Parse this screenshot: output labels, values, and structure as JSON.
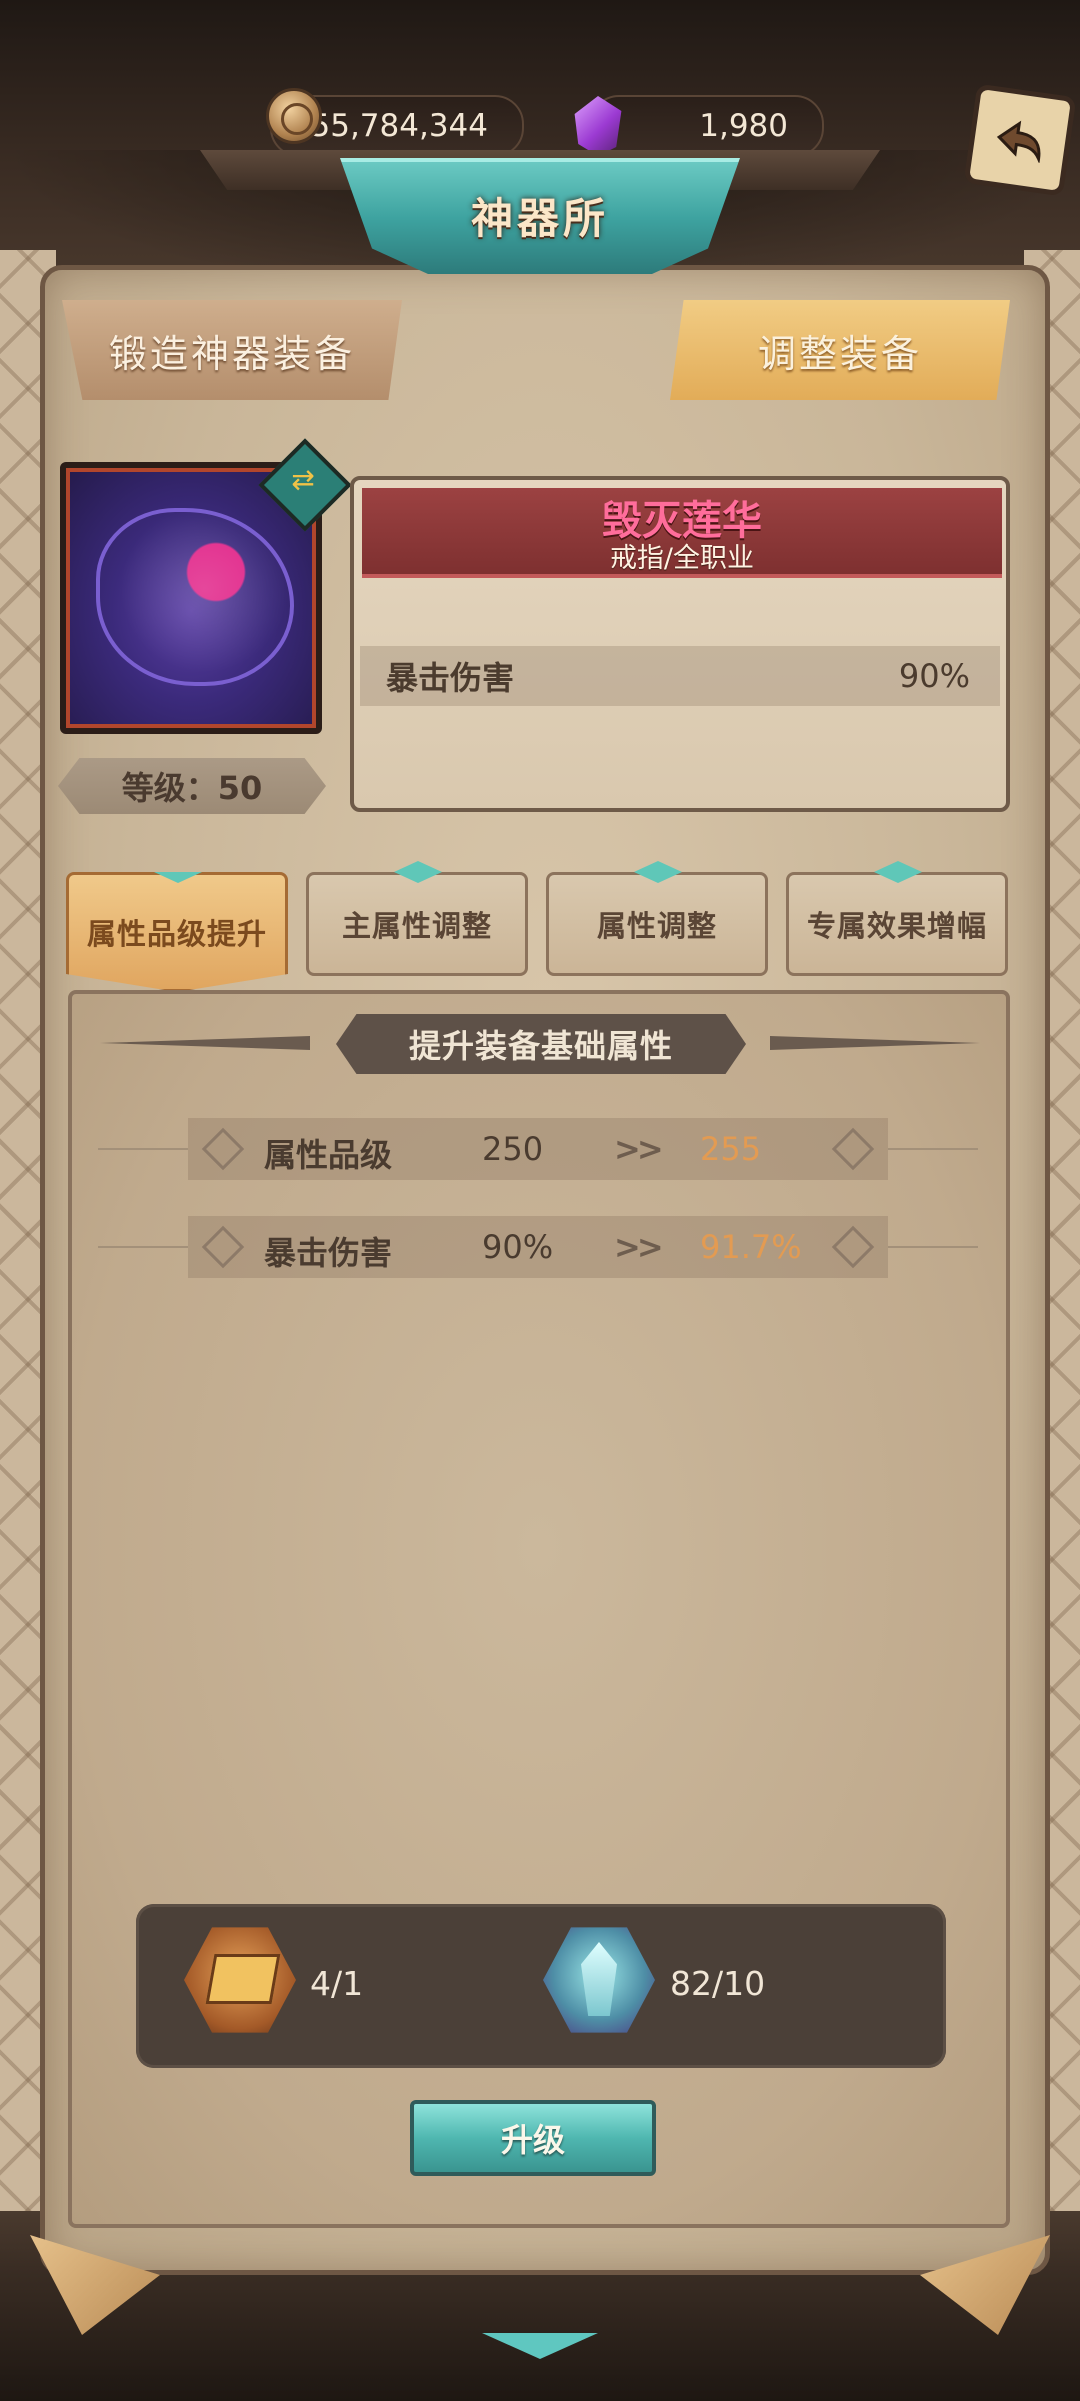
{
  "currency": {
    "gold_icon": "coin-icon",
    "gold": "55,784,344",
    "gem_icon": "purple-gem-icon",
    "gems": "1,980"
  },
  "header": {
    "title": "神器所",
    "back_icon": "back-arrow-icon"
  },
  "top_buttons": {
    "forge": "锻造神器装备",
    "adjust": "调整装备"
  },
  "item": {
    "name": "毁灭莲华",
    "type": "戒指/全职业",
    "level": "等级：50",
    "stat_label": "暴击伤害",
    "stat_value": "90%",
    "name_color": "#ff6d9b"
  },
  "tabs": [
    {
      "label": "属性品级提升",
      "active": true
    },
    {
      "label": "主属性调整",
      "active": false
    },
    {
      "label": "属性调整",
      "active": false
    },
    {
      "label": "专属效果增幅",
      "active": false
    }
  ],
  "section": {
    "title": "提升装备基础属性"
  },
  "compare_rows": [
    {
      "label": "属性品级",
      "from": "250",
      "arrow": ">>",
      "to": "255"
    },
    {
      "label": "暴击伤害",
      "from": "90%",
      "arrow": ">>",
      "to": "91.7%"
    }
  ],
  "materials": [
    {
      "icon": "gold-ingot-icon",
      "count": "4/1"
    },
    {
      "icon": "crystal-icon",
      "count": "82/10"
    }
  ],
  "upgrade_label": "升级",
  "colors": {
    "accent_teal": "#4fb7b0",
    "upgrade_highlight": "#e39b52"
  }
}
